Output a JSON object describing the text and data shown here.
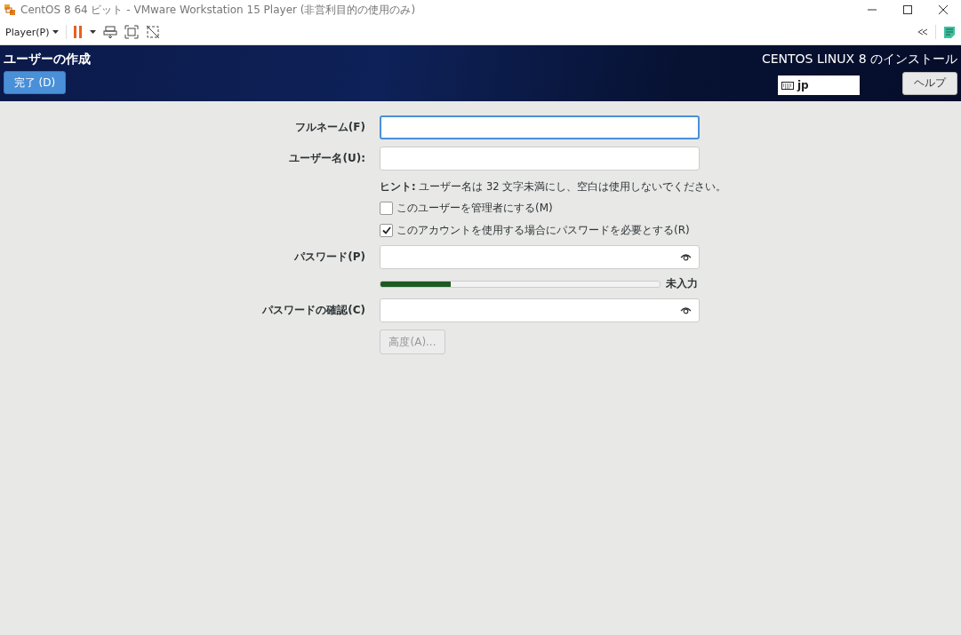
{
  "window": {
    "title": "CentOS 8 64 ビット - VMware Workstation 15 Player (非営利目的の使用のみ)"
  },
  "toolbar": {
    "player_menu": "Player(P)"
  },
  "header": {
    "title": "ユーザーの作成",
    "done_button": "完了 (D)",
    "product": "CENTOS LINUX 8 のインストール",
    "keyboard_layout": "jp",
    "help_button": "ヘルプ"
  },
  "form": {
    "full_name": {
      "label": "フルネーム(F)",
      "focused": true
    },
    "user_name": {
      "label": "ユーザー名(U):",
      "focused": false
    },
    "hint": "**ヒント:** ユーザー名は 32 文字未満にし、空白は使用しないでください。",
    "checkboxes": [
      {
        "label": "このユーザーを管理者にする(M)",
        "checked": false
      },
      {
        "label": "このアカウントを使用する場合にパスワードを必要とする(R)",
        "checked": true
      }
    ],
    "password": {
      "label": "パスワード(P)",
      "focused": false
    },
    "strength": {
      "level": 0.25,
      "reading": "未入力"
    },
    "confirm_password": {
      "label": "パスワードの確認(C)",
      "focused": false
    },
    "advanced_button": {
      "label": "高度(A)...",
      "disabled": true
    }
  }
}
